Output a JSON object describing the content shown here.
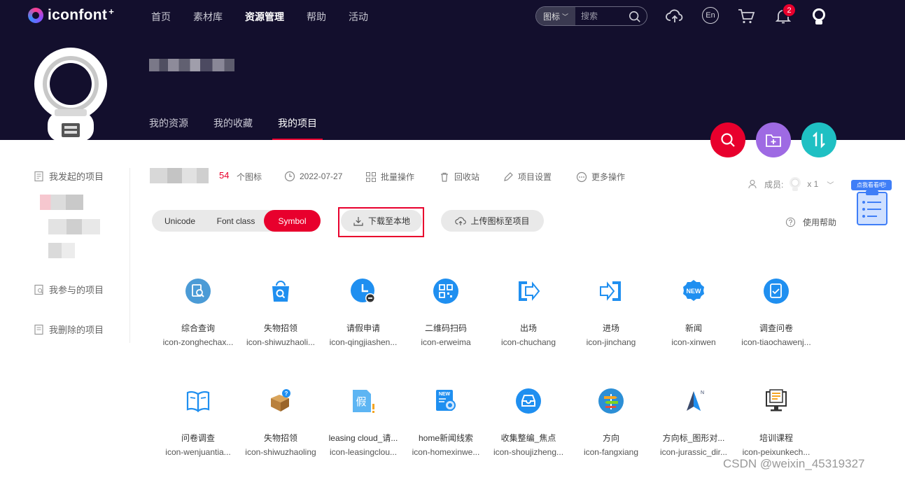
{
  "colors": {
    "header_bg": "#130f2d",
    "accent": "#e8002d",
    "icon_blue": "#1f8ff0",
    "purple": "#9e6ae3",
    "teal": "#1fc0c3"
  },
  "logo": {
    "text": "iconfont",
    "plus": "+"
  },
  "nav": [
    "首页",
    "素材库",
    "资源管理",
    "帮助",
    "活动"
  ],
  "nav_active_index": 2,
  "search": {
    "type_label": "图标",
    "placeholder": "搜索"
  },
  "header_icons": [
    "upload-cloud-icon",
    "language-en-icon",
    "cart-icon",
    "bell-icon",
    "user-avatar-icon"
  ],
  "notification_count": "2",
  "language_label": "En",
  "profile_tabs": [
    "我的资源",
    "我的收藏",
    "我的项目"
  ],
  "profile_tab_active_index": 2,
  "sidebar": {
    "initiated": "我发起的项目",
    "joined": "我参与的项目",
    "deleted": "我删除的项目"
  },
  "project": {
    "icon_count": "54",
    "icon_count_unit": "个图标",
    "date": "2022-07-27",
    "batch": "批量操作",
    "recycle": "回收站",
    "settings": "项目设置",
    "more": "更多操作",
    "members_label": "成员:",
    "members_count": "x 1",
    "help": "使用帮助"
  },
  "float_widget_label": "点我看看吧!",
  "format_tabs": [
    "Unicode",
    "Font class",
    "Symbol"
  ],
  "format_tab_active_index": 2,
  "download_label": "下载至本地",
  "upload_label": "上传图标至项目",
  "icons": [
    {
      "cn": "综合查询",
      "en": "icon-zonghechax...",
      "glyph": "search-circle-icon"
    },
    {
      "cn": "失物招领",
      "en": "icon-shiwuzhaoli...",
      "glyph": "lost-bag-icon"
    },
    {
      "cn": "请假申请",
      "en": "icon-qingjiashen...",
      "glyph": "leave-clock-icon"
    },
    {
      "cn": "二维码扫码",
      "en": "icon-erweima",
      "glyph": "qr-code-icon"
    },
    {
      "cn": "出场",
      "en": "icon-chuchang",
      "glyph": "exit-icon"
    },
    {
      "cn": "进场",
      "en": "icon-jinchang",
      "glyph": "enter-icon"
    },
    {
      "cn": "新闻",
      "en": "icon-xinwen",
      "glyph": "news-badge-icon"
    },
    {
      "cn": "调查问卷",
      "en": "icon-tiaochawenj...",
      "glyph": "survey-circle-icon"
    },
    {
      "cn": "问卷调查",
      "en": "icon-wenjuantia...",
      "glyph": "open-book-icon"
    },
    {
      "cn": "失物招领",
      "en": "icon-shiwuzhaoling",
      "glyph": "lost-box-icon"
    },
    {
      "cn": "leasing cloud_请...",
      "en": "icon-leasingclou...",
      "glyph": "leave-doc-icon"
    },
    {
      "cn": "home新闻线索",
      "en": "icon-homexinwe...",
      "glyph": "news-doc-icon"
    },
    {
      "cn": "收集整编_焦点",
      "en": "icon-shoujizheng...",
      "glyph": "inbox-circle-icon"
    },
    {
      "cn": "方向",
      "en": "icon-fangxiang",
      "glyph": "signpost-icon"
    },
    {
      "cn": "方向标_图形对...",
      "en": "icon-jurassic_dir...",
      "glyph": "compass-icon"
    },
    {
      "cn": "培训课程",
      "en": "icon-peixunkech...",
      "glyph": "training-monitor-icon"
    }
  ],
  "watermark": "CSDN @weixin_45319327"
}
